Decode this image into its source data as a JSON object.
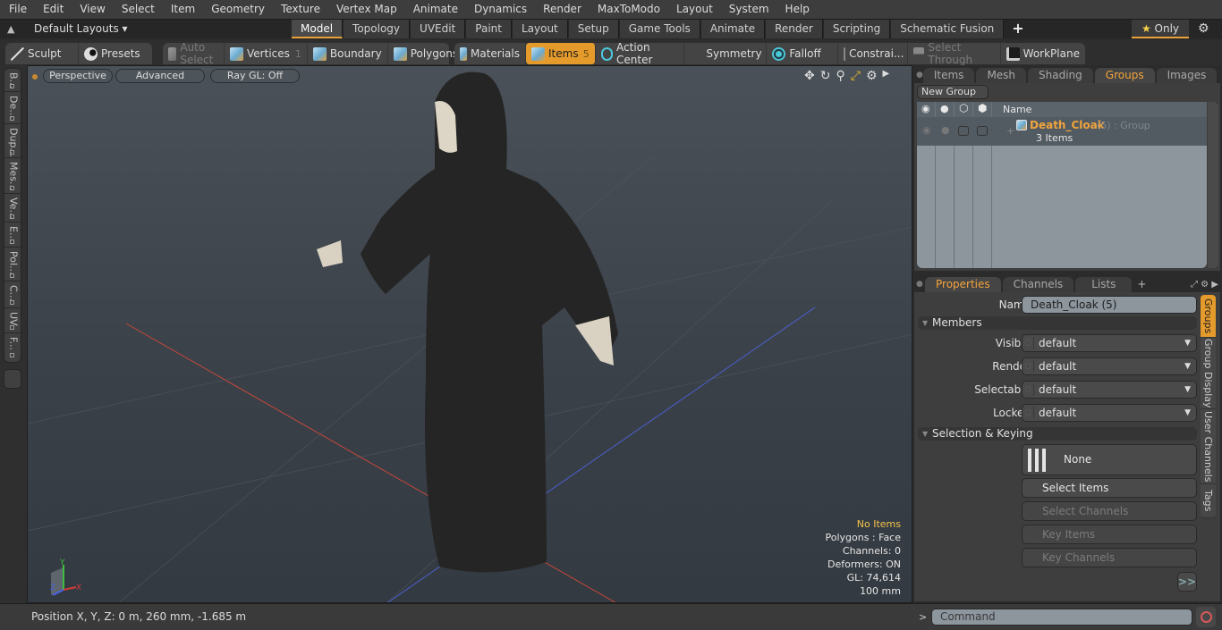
{
  "menubar": [
    "File",
    "Edit",
    "View",
    "Select",
    "Item",
    "Geometry",
    "Texture",
    "Vertex Map",
    "Animate",
    "Dynamics",
    "Render",
    "MaxToModo",
    "Layout",
    "System",
    "Help"
  ],
  "layoutbar": {
    "layouts_label": "Default Layouts ▾",
    "tabs": [
      "Model",
      "Topology",
      "UVEdit",
      "Paint",
      "Layout",
      "Setup",
      "Game Tools",
      "Animate",
      "Render",
      "Scripting",
      "Schematic Fusion"
    ],
    "active_tab": "Model",
    "add_tab": "+",
    "only_star": "★",
    "only_label": "Only"
  },
  "toolbar": {
    "sculpt": "Sculpt",
    "presets": "Presets",
    "auto_select": "Auto Select",
    "vertices": "Vertices",
    "vertices_count": "1",
    "boundary": "Boundary",
    "polygons": "Polygons",
    "materials": "Materials",
    "items": "Items",
    "items_count": "5",
    "action_center": "Action Center",
    "symmetry": "Symmetry",
    "falloff": "Falloff",
    "constraints": "Constrai...",
    "select_through": "Select Through",
    "workplane": "WorkPlane"
  },
  "left_tabs": [
    "B...",
    "De...",
    "Dup...",
    "Mes...",
    "Ve...",
    "E...",
    "Pol...",
    "C...",
    "UV",
    "F..."
  ],
  "viewport": {
    "view_mode": "Perspective",
    "shading": "Advanced",
    "raygl": "Ray GL: Off",
    "info": {
      "items": "No Items",
      "polygons": "Polygons : Face",
      "channels": "Channels: 0",
      "deformers": "Deformers: ON",
      "gl": "GL: 74,614",
      "scale": "100 mm"
    },
    "axes": {
      "x": "X",
      "y": "Y",
      "z": "Z"
    }
  },
  "groups_panel": {
    "tabs": [
      "Items",
      "Mesh ...",
      "Shading",
      "Groups",
      "Images"
    ],
    "active_tab": "Groups",
    "new_group": "New Group",
    "column_name": "Name",
    "row": {
      "name": "Death_Cloak",
      "suffix": "(5) : Group",
      "count": "3 Items",
      "expand": "+"
    }
  },
  "properties_panel": {
    "tabs": [
      "Properties",
      "Channels",
      "Lists"
    ],
    "active_tab": "Properties",
    "name_label": "Name",
    "name_value": "Death_Cloak (5)",
    "members_section": "Members",
    "fields": [
      {
        "label": "Visible",
        "value": "default"
      },
      {
        "label": "Render",
        "value": "default"
      },
      {
        "label": "Selectable",
        "value": "default"
      },
      {
        "label": "Locked",
        "value": "default"
      }
    ],
    "selection_section": "Selection & Keying",
    "none_button": "None",
    "select_items": "Select Items",
    "select_channels": "Select Channels",
    "key_items": "Key Items",
    "key_channels": "Key Channels",
    "more": ">>",
    "side_tabs": [
      "Groups",
      "Group Display",
      "User Channels",
      "Tags"
    ]
  },
  "status": {
    "position": "Position X, Y, Z:   0 m, 260 mm, -1.685 m"
  },
  "command": {
    "prompt": ">",
    "placeholder": "Command"
  },
  "colors": {
    "accent": "#e59b2c",
    "group_name": "#f0a43c",
    "info_highlight": "#f3c34a"
  }
}
